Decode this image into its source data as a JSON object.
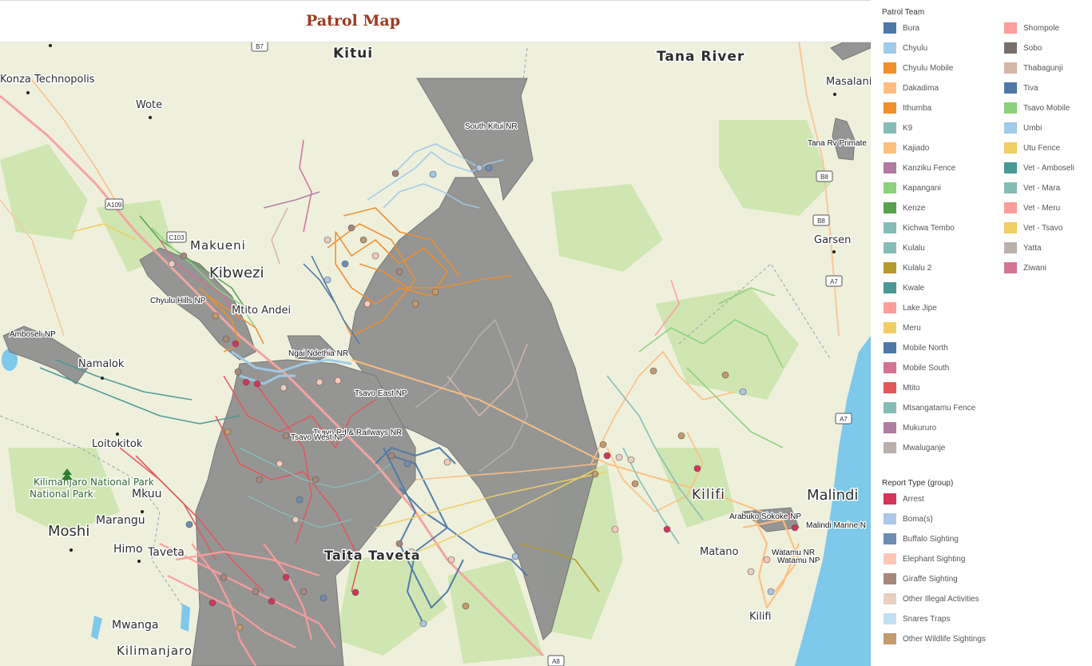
{
  "title": "Patrol Map",
  "map": {
    "roads": [
      "B7",
      "A109",
      "B8",
      "B8",
      "A7",
      "A7",
      "A8",
      "C103"
    ],
    "places": [
      {
        "name": "Kitui",
        "size": "city"
      },
      {
        "name": "Tana River",
        "size": "region"
      },
      {
        "name": "Konza Technopolis",
        "size": "town"
      },
      {
        "name": "Wote",
        "size": "town"
      },
      {
        "name": "Makueni",
        "size": "city"
      },
      {
        "name": "Kibwezi",
        "size": "city"
      },
      {
        "name": "Mtito Andei",
        "size": "town"
      },
      {
        "name": "Namalok",
        "size": "town"
      },
      {
        "name": "Loitokitok",
        "size": "town"
      },
      {
        "name": "Kilimanjaro National Park",
        "size": "park"
      },
      {
        "name": "Mkuu",
        "size": "town"
      },
      {
        "name": "Moshi",
        "size": "city"
      },
      {
        "name": "Marangu",
        "size": "town"
      },
      {
        "name": "Himo",
        "size": "town"
      },
      {
        "name": "Taveta",
        "size": "town"
      },
      {
        "name": "Mwanga",
        "size": "town"
      },
      {
        "name": "Kilimanjaro",
        "size": "city"
      },
      {
        "name": "Taita Taveta",
        "size": "city"
      },
      {
        "name": "Masalani",
        "size": "town"
      },
      {
        "name": "Garsen",
        "size": "town"
      },
      {
        "name": "Kilifi",
        "size": "city"
      },
      {
        "name": "Malindi",
        "size": "city"
      },
      {
        "name": "Matano",
        "size": "town"
      },
      {
        "name": "Kilifi",
        "size": "town"
      }
    ],
    "protected_areas": [
      "South Kitui NR",
      "Tana Rv Primate",
      "Chyulu Hills NP",
      "Amboseli NP",
      "Ngai Ndethia NR",
      "Tsavo East NP",
      "Tsavo Rd & Railways NR",
      "Tsavo West NP",
      "Arabuko Sokoke NP",
      "Malindi Marine N",
      "Watamu NR",
      "Watamu NP"
    ]
  },
  "legend": {
    "patrol_team_title": "Patrol Team",
    "patrol_teams": [
      {
        "label": "Bura",
        "color": "#4e79a7"
      },
      {
        "label": "Chyulu",
        "color": "#a0cbe8"
      },
      {
        "label": "Chyulu Mobile",
        "color": "#f28e2b"
      },
      {
        "label": "Dakadima",
        "color": "#ffbe7d"
      },
      {
        "label": "Ithumba",
        "color": "#f28e2b"
      },
      {
        "label": "K9",
        "color": "#86bcb6"
      },
      {
        "label": "Kajiado",
        "color": "#ffbe7d"
      },
      {
        "label": "Kanziku Fence",
        "color": "#b07aa1"
      },
      {
        "label": "Kapangani",
        "color": "#8cd17d"
      },
      {
        "label": "Kenze",
        "color": "#59a14f"
      },
      {
        "label": "Kichwa Tembo",
        "color": "#86bcb6"
      },
      {
        "label": "Kulalu",
        "color": "#86bcb6"
      },
      {
        "label": "Kulalu 2",
        "color": "#b6992d"
      },
      {
        "label": "Kwale",
        "color": "#499894"
      },
      {
        "label": "Lake Jipe",
        "color": "#ff9d9a"
      },
      {
        "label": "Meru",
        "color": "#f1ce63"
      },
      {
        "label": "Mobile North",
        "color": "#4e79a7"
      },
      {
        "label": "Mobile South",
        "color": "#d37295"
      },
      {
        "label": "Mtito",
        "color": "#e15759"
      },
      {
        "label": "Mtsangatamu Fence",
        "color": "#86bcb6"
      },
      {
        "label": "Mukururo",
        "color": "#b07aa1"
      },
      {
        "label": "Mwaluganje",
        "color": "#bab0ac"
      },
      {
        "label": "Shompole",
        "color": "#ff9d9a"
      },
      {
        "label": "Sobo",
        "color": "#79706e"
      },
      {
        "label": "Thabagunji",
        "color": "#d7b5a6"
      },
      {
        "label": "Tiva",
        "color": "#4e79a7"
      },
      {
        "label": "Tsavo Mobile",
        "color": "#8cd17d"
      },
      {
        "label": "Umbi",
        "color": "#a0cbe8"
      },
      {
        "label": "Utu Fence",
        "color": "#f1ce63"
      },
      {
        "label": "Vet - Amboseli",
        "color": "#499894"
      },
      {
        "label": "Vet - Mara",
        "color": "#86bcb6"
      },
      {
        "label": "Vet - Meru",
        "color": "#ff9d9a"
      },
      {
        "label": "Vet - Tsavo",
        "color": "#f1ce63"
      },
      {
        "label": "Yatta",
        "color": "#bab0ac"
      },
      {
        "label": "Ziwani",
        "color": "#d37295"
      }
    ],
    "report_type_title": "Report Type (group)",
    "report_types": [
      {
        "label": "Arrest",
        "color": "#d1365a"
      },
      {
        "label": "Boma(s)",
        "color": "#aec7e8"
      },
      {
        "label": "Buffalo Sighting",
        "color": "#6f8db3"
      },
      {
        "label": "Elephant Sighting",
        "color": "#ffc6b8"
      },
      {
        "label": "Giraffe Sighting",
        "color": "#a7877a"
      },
      {
        "label": "Other Illegal Activities",
        "color": "#e8cfc2"
      },
      {
        "label": "Snares Traps",
        "color": "#c3def2"
      },
      {
        "label": "Other Wildlife Sightings",
        "color": "#c49a6c"
      }
    ]
  }
}
